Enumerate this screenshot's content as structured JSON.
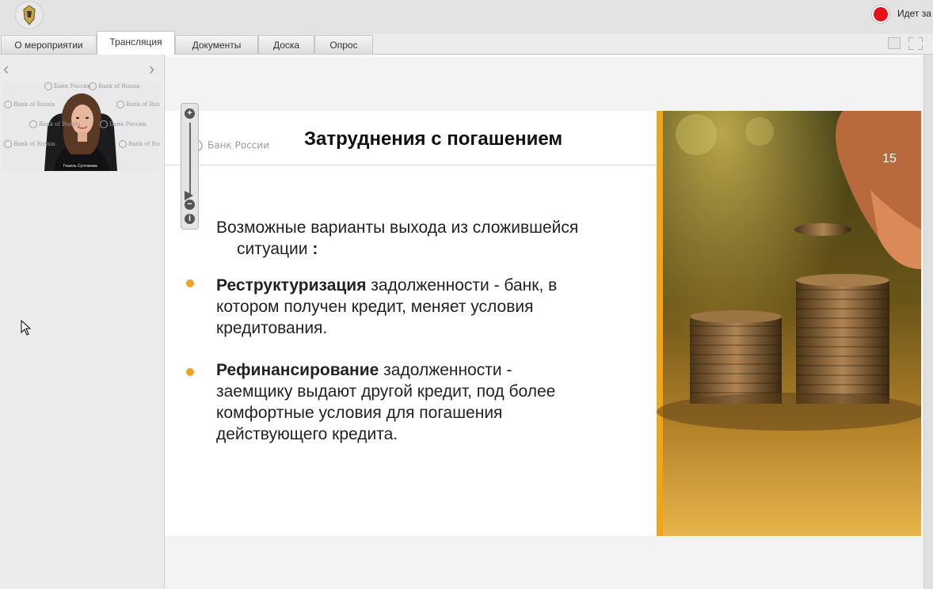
{
  "topbar": {
    "logo_icon": "org-crest-logo",
    "recording_label": "Идет за"
  },
  "tabs": [
    {
      "label": "О мероприятии",
      "active": false
    },
    {
      "label": "Трансляция",
      "active": true
    },
    {
      "label": "Документы",
      "active": false
    },
    {
      "label": "Доска",
      "active": false
    },
    {
      "label": "Опрос",
      "active": false
    }
  ],
  "video": {
    "watermark": "Bank of Russia",
    "watermark_ru": "Банк России",
    "speaker_name": "Гюзель Султанова"
  },
  "slide": {
    "logo_text": "Банк России",
    "title": "Затруднения с погашением",
    "page_number": "15",
    "intro_line1": "Возможные варианты выхода из сложившейся",
    "intro_line2": "ситуации",
    "intro_colon": ":",
    "bullets": [
      {
        "bold": "Реструктуризация",
        "rest_l1": " задолженности - банк, в",
        "l2": "котором получен кредит, меняет условия",
        "l3": "кредитования."
      },
      {
        "bold": "Рефинансирование",
        "rest_l1": " задолженности -",
        "l2": "заемщику выдают другой кредит, под более",
        "l3": "комфортные условия для погашения",
        "l4": "действующего кредита."
      }
    ],
    "accent_color": "#f2a31c"
  },
  "zoom": {
    "in": "+",
    "out": "−",
    "info": "i"
  }
}
